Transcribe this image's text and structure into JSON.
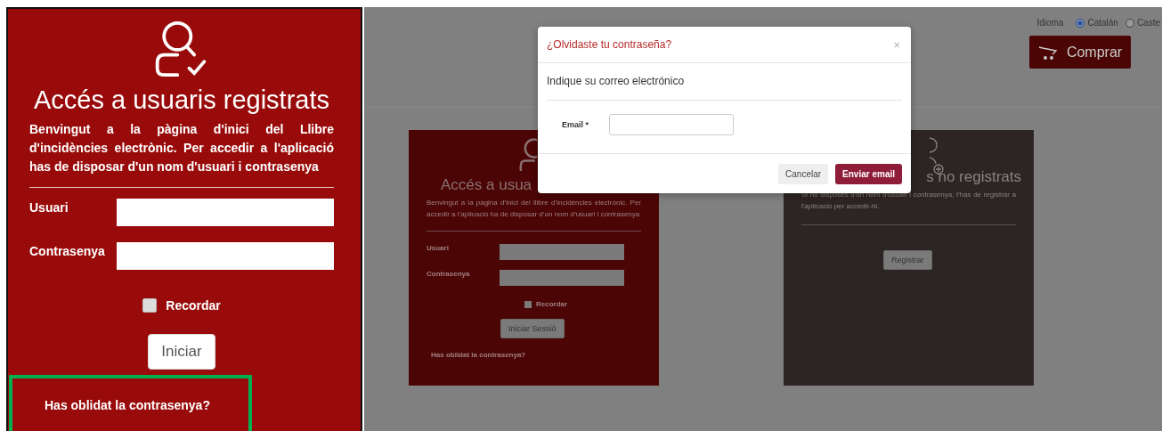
{
  "zoom_panel": {
    "title": "Accés a usuaris registrats",
    "intro": "Benvingut a la pàgina d'inici del Llibre d'incidències electrònic. Per accedir a l'aplicació has de disposar d'un nom d'usuari i contrasenya",
    "fields": [
      {
        "label": "Usuari"
      },
      {
        "label": "Contrasenya"
      }
    ],
    "remember": {
      "label": "Recordar",
      "checked": false
    },
    "button": "Iniciar",
    "forgot_link": "Has oblidat la contrasenya?",
    "highlighted": true
  },
  "header": {
    "language_label": "Idioma",
    "languages": [
      {
        "label": "Catalán",
        "selected": true
      },
      {
        "label": "Caste",
        "selected": false
      }
    ],
    "buy_button": "Comprar"
  },
  "registered_card": {
    "title": "Accés a usua",
    "intro": "Benvingut a la pàgina d’inici del llibre d’incidències electrònic. Per accedir a l’aplicació ha de disposar d’un nom d’usuari i contrasenya",
    "fields": [
      {
        "label": "Usuari"
      },
      {
        "label": "Contrasenya"
      }
    ],
    "remember": {
      "label": "Recordar",
      "checked": false
    },
    "button": "Iniciar Sessió",
    "forgot_link": "Has oblidat la contrasenya?"
  },
  "unregistered_card": {
    "title": "s no registrats",
    "intro": "Si no disposes d'un nom d'usuari i contrasenya, t'has de registrar a l'aplicació per accedir-hi.",
    "button": "Registrar"
  },
  "modal": {
    "title": "¿Olvidaste tu contraseña?",
    "close": "×",
    "prompt": "Indique su correo electrónico",
    "field": {
      "label": "Email *"
    },
    "buttons": [
      {
        "label": "Cancelar",
        "kind": "secondary"
      },
      {
        "label": "Enviar email",
        "kind": "primary"
      }
    ]
  }
}
